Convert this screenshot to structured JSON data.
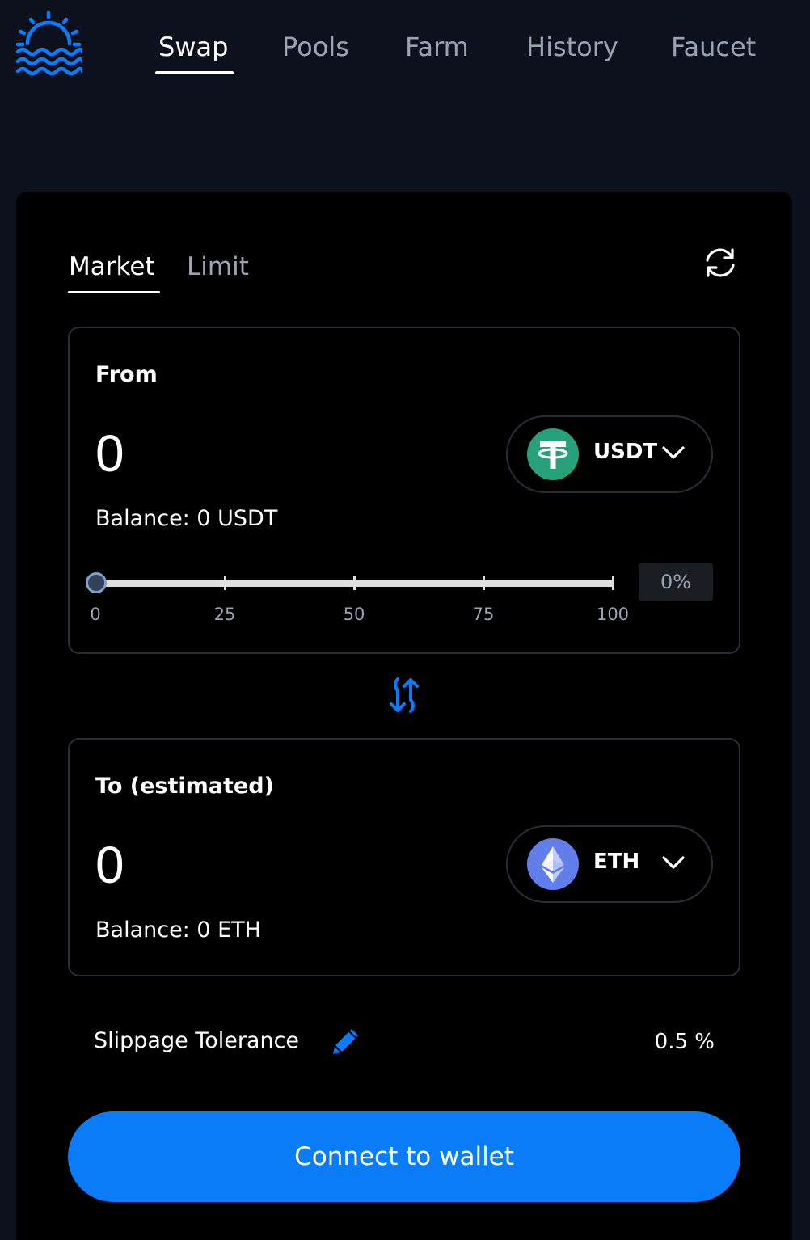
{
  "nav": {
    "tabs": [
      {
        "label": "Swap",
        "active": true
      },
      {
        "label": "Pools",
        "active": false
      },
      {
        "label": "Farm",
        "active": false
      },
      {
        "label": "History",
        "active": false
      },
      {
        "label": "Faucet",
        "active": false
      }
    ]
  },
  "swap": {
    "modes": [
      {
        "label": "Market",
        "active": true
      },
      {
        "label": "Limit",
        "active": false
      }
    ],
    "from": {
      "label": "From",
      "amount": "0",
      "balance": "Balance: 0 USDT",
      "token": {
        "symbol": "USDT",
        "icon": "usdt-icon",
        "color": "#26a17b"
      },
      "slider": {
        "value_percent": 0,
        "ticks": [
          "0",
          "25",
          "50",
          "75",
          "100"
        ],
        "percent_display": "0%"
      }
    },
    "to": {
      "label": "To (estimated)",
      "amount": "0",
      "balance": "Balance: 0 ETH",
      "token": {
        "symbol": "ETH",
        "icon": "eth-icon",
        "color": "#627eea"
      }
    },
    "slippage": {
      "label": "Slippage Tolerance",
      "value": "0.5 %"
    },
    "connect_label": "Connect to wallet"
  },
  "colors": {
    "background": "#0c111d",
    "card": "#000000",
    "accent": "#0a7cf7",
    "muted_text": "#9aa3b2"
  }
}
